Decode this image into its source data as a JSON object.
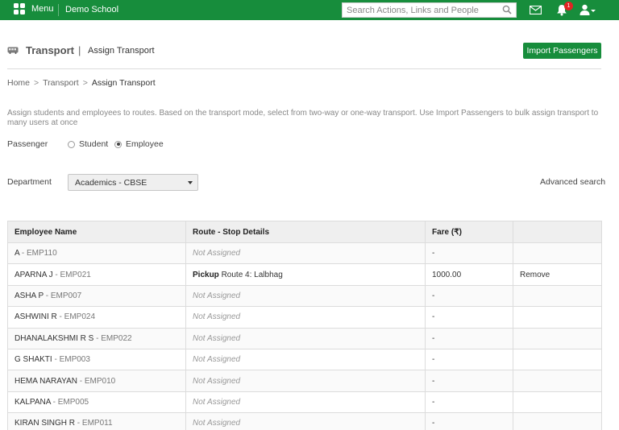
{
  "topbar": {
    "menu_label": "Menu",
    "school_name": "Demo School",
    "search_placeholder": "Search Actions, Links and People",
    "notification_count": "1",
    "bg_color": "#178d3c"
  },
  "page": {
    "title": "Transport",
    "separator": "|",
    "subtitle": "Assign Transport",
    "import_button": "Import Passengers"
  },
  "breadcrumb": {
    "items": [
      "Home",
      "Transport"
    ],
    "current": "Assign Transport",
    "separator": ">"
  },
  "description": "Assign students and employees to routes. Based on the transport mode, select from two-way or one-way transport. Use Import Passengers to bulk assign transport to many users at once",
  "passenger": {
    "label": "Passenger",
    "options": [
      "Student",
      "Employee"
    ],
    "selected": "Employee"
  },
  "department": {
    "label": "Department",
    "selected": "Academics - CBSE",
    "advanced_search": "Advanced search"
  },
  "table": {
    "headers": [
      "Employee Name",
      "Route - Stop Details",
      "Fare (₹)",
      ""
    ],
    "rows": [
      {
        "name": "A",
        "code": "EMP110",
        "route": "Not Assigned",
        "pickup": "",
        "fare": "-",
        "action": ""
      },
      {
        "name": "APARNA J",
        "code": "EMP021",
        "route": "Route 4: Lalbhag",
        "pickup": "Pickup",
        "fare": "1000.00",
        "action": "Remove"
      },
      {
        "name": "ASHA P",
        "code": "EMP007",
        "route": "Not Assigned",
        "pickup": "",
        "fare": "-",
        "action": ""
      },
      {
        "name": "ASHWINI R",
        "code": "EMP024",
        "route": "Not Assigned",
        "pickup": "",
        "fare": "-",
        "action": ""
      },
      {
        "name": "DHANALAKSHMI R S",
        "code": "EMP022",
        "route": "Not Assigned",
        "pickup": "",
        "fare": "-",
        "action": ""
      },
      {
        "name": "G SHAKTI",
        "code": "EMP003",
        "route": "Not Assigned",
        "pickup": "",
        "fare": "-",
        "action": ""
      },
      {
        "name": "HEMA NARAYAN",
        "code": "EMP010",
        "route": "Not Assigned",
        "pickup": "",
        "fare": "-",
        "action": ""
      },
      {
        "name": "KALPANA",
        "code": "EMP005",
        "route": "Not Assigned",
        "pickup": "",
        "fare": "-",
        "action": ""
      },
      {
        "name": "KIRAN SINGH R",
        "code": "EMP011",
        "route": "Not Assigned",
        "pickup": "",
        "fare": "-",
        "action": ""
      }
    ]
  }
}
